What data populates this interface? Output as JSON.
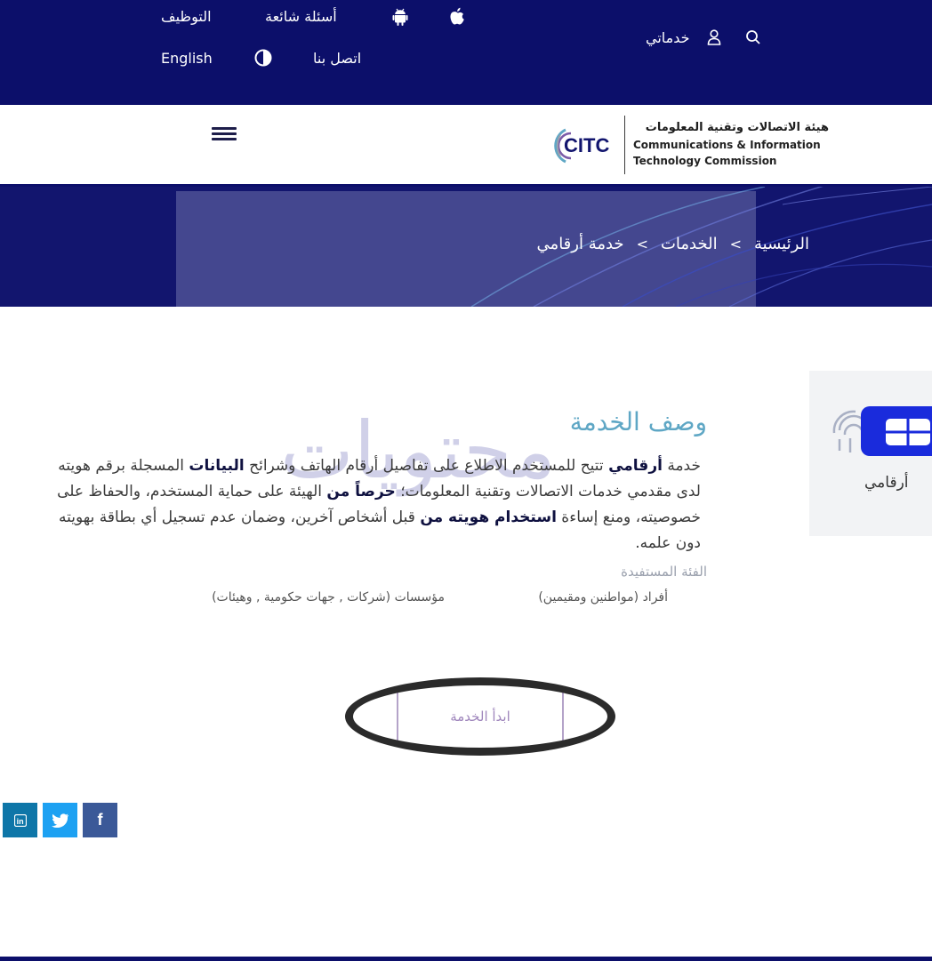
{
  "top_bar": {
    "careers": "التوظيف",
    "faq": "أسئلة شائعة",
    "android_icon": "android-icon",
    "apple_icon": "apple-icon",
    "language": "English",
    "contrast_icon": "contrast-icon",
    "contact": "اتصل بنا",
    "my_services": "خدماتي",
    "user_icon": "user-icon",
    "search_icon": "search-icon"
  },
  "header": {
    "logo_mark": "CITC",
    "logo_ar": "هيئة الاتصالات وتقنية المعلومات",
    "logo_en_line1": "Communications & Information",
    "logo_en_line2": "Technology Commission",
    "menu_icon": "hamburger-menu-icon"
  },
  "breadcrumb": {
    "home": "الرئيسية",
    "sep1": ">",
    "services": "الخدمات",
    "sep2": ">",
    "current": "خدمة أرقامي"
  },
  "watermark": "محتويات",
  "service": {
    "title": "وصف الخدمة",
    "desc_1": "خدمة ",
    "desc_2": "أرقامي",
    "desc_3": " تتيح للمستخدم الاطلاع على تفاصيل أرقام الهاتف وشرائح ",
    "desc_4": "البيانات",
    "desc_5": " المسجلة برقم هويته لدى مقدمي خدمات الاتصالات وتقنية المعلومات؛ ",
    "desc_6": "حرصاً من",
    "desc_7": " الهيئة على حماية المستخدم، والحفاظ على خصوصيته، ومنع إساءة ",
    "desc_8": "استخدام هويته من",
    "desc_9": " قبل أشخاص آخرين، وضمان عدم تسجيل أي بطاقة بهويته دون علمه.",
    "audience_label": "الفئة المستفيدة",
    "audience_individuals": "أفراد (مواطنين ومقيمين)",
    "audience_entities": "مؤسسات (شركات , جهات حكومية , وهيئات)",
    "start_button": "ابدأ الخدمة"
  },
  "side_card": {
    "label": "أرقامي",
    "icon": "sim-fingerprint-icon"
  },
  "social": {
    "linkedin": "in",
    "twitter": "twitter-icon",
    "facebook": "f"
  },
  "colors": {
    "navy": "#0c0f6a",
    "hero_panel": "#44478f",
    "title_blue": "#5fa7c5",
    "button_text": "#9f86bc"
  }
}
